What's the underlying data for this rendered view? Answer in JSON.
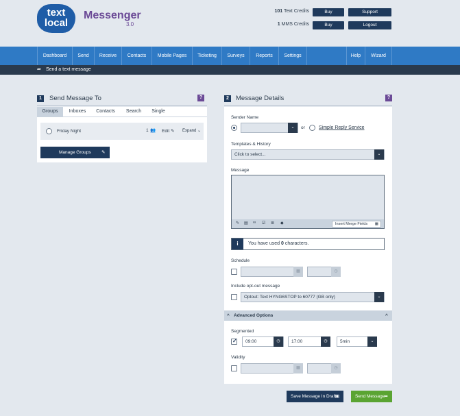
{
  "header": {
    "logo_line1": "text",
    "logo_line2": "local",
    "app_name": "Messenger",
    "app_version": "3.0",
    "text_credits_count": "101",
    "text_credits_label": "Text Credits",
    "mms_credits_count": "1",
    "mms_credits_label": "MMS Credits",
    "buy_label": "Buy",
    "support_label": "Support",
    "logout_label": "Logout"
  },
  "nav": {
    "items": [
      "Dashboard",
      "Send",
      "Receive",
      "Contacts",
      "Mobile Pages",
      "Ticketing",
      "Surveys",
      "Reports",
      "Settings",
      "Help",
      "Wizard"
    ]
  },
  "subbar": {
    "label": "Send a text message"
  },
  "send_to": {
    "step": "1",
    "title": "Send Message To",
    "help": "?",
    "tabs": [
      "Groups",
      "Inboxes",
      "Contacts",
      "Search",
      "Single"
    ],
    "active_tab": "Groups",
    "group": {
      "name": "Friday Night",
      "count": "1",
      "edit_label": "Edit",
      "expand_label": "Expand"
    },
    "manage_label": "Manage Groups"
  },
  "details": {
    "step": "2",
    "title": "Message Details",
    "help": "?",
    "sender_name_label": "Sender Name",
    "sender_name_value": "",
    "or_label": "or",
    "simple_reply_label": "Simple Reply Service",
    "templates_label": "Templates & History",
    "templates_placeholder": "Click to select...",
    "message_label": "Message",
    "message_value": "",
    "insert_merge_label": "Insert Merge Fields",
    "chars_prefix": "You have used ",
    "chars_count": "0",
    "chars_suffix": " characters.",
    "schedule_label": "Schedule",
    "optout_label": "Include opt-out message",
    "optout_value": "Optout: Text HYNG6STOP to 60777 (GB only)",
    "advanced_label": "Advanced Options",
    "segmented_label": "Segmented",
    "seg_start": "09:00",
    "seg_end": "17:00",
    "seg_interval": "5min",
    "validity_label": "Validity",
    "save_draft_label": "Save Message In Drafts",
    "send_label": "Send Message"
  }
}
